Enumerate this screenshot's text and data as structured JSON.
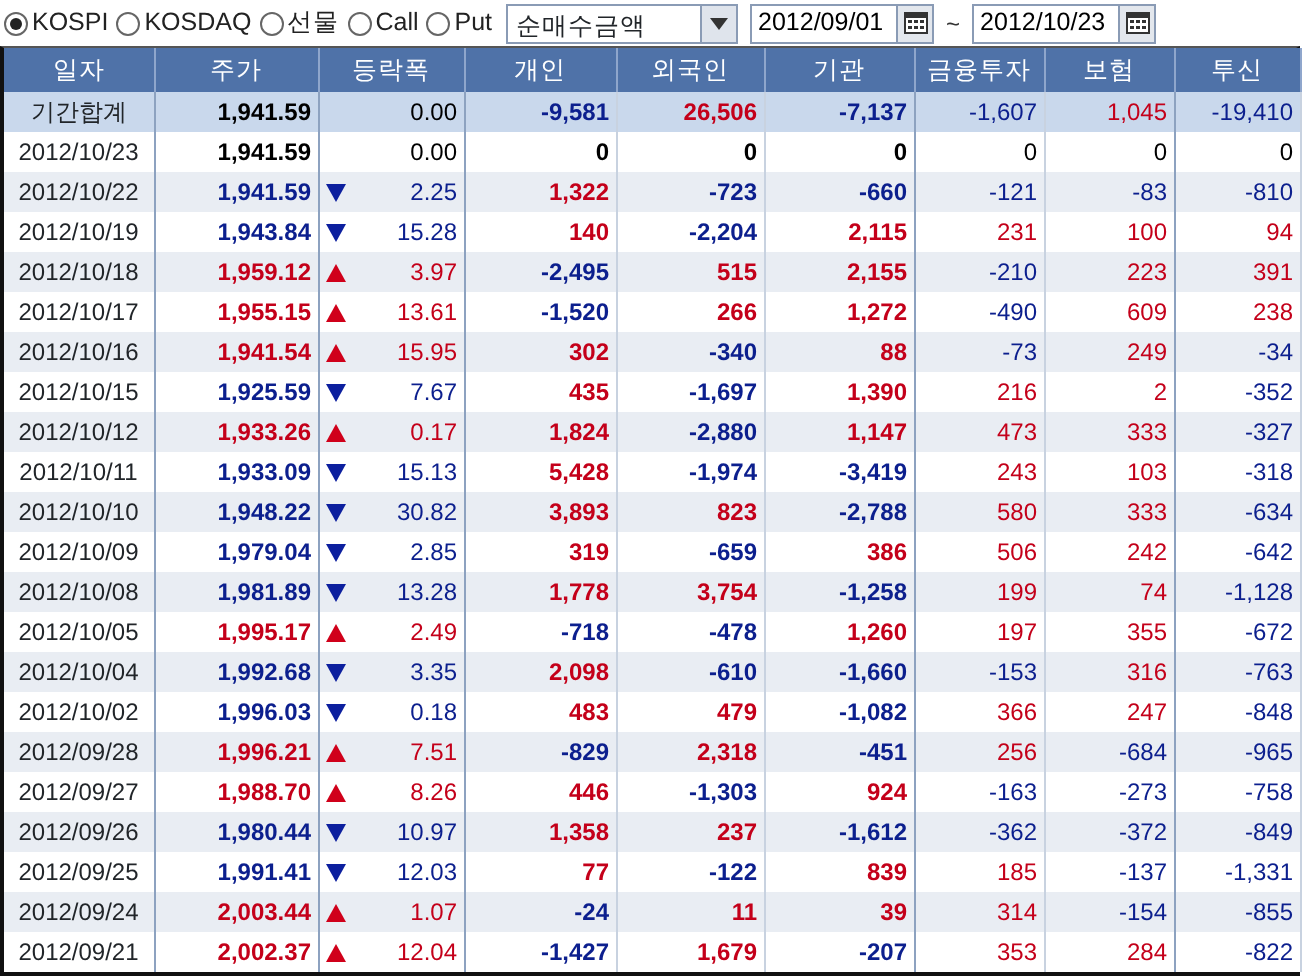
{
  "toolbar": {
    "markets": [
      {
        "label": "KOSPI",
        "selected": true
      },
      {
        "label": "KOSDAQ",
        "selected": false
      },
      {
        "label": "선물",
        "selected": false
      },
      {
        "label": "Call",
        "selected": false
      },
      {
        "label": "Put",
        "selected": false
      }
    ],
    "measure": "순매수금액",
    "date_from": "2012/09/01",
    "separator": "~",
    "date_to": "2012/10/23"
  },
  "table": {
    "columns": [
      "일자",
      "주가",
      "등락폭",
      "개인",
      "외국인",
      "기관",
      "금융투자",
      "보험",
      "투신"
    ],
    "rows": [
      {
        "kind": "total",
        "date": "기간합계",
        "price": {
          "text": "1,941.59",
          "color": "#000000"
        },
        "change": {
          "kind": "none",
          "text": "0.00",
          "color": "#000000"
        },
        "values": [
          {
            "text": "-9,581",
            "color": "#0c1f8e"
          },
          {
            "text": "26,506",
            "color": "#c4001a"
          },
          {
            "text": "-7,137",
            "color": "#0c1f8e"
          },
          {
            "text": "-1,607",
            "color": "#0c1f8e"
          },
          {
            "text": "1,045",
            "color": "#c4001a"
          },
          {
            "text": "-19,410",
            "color": "#0c1f8e"
          }
        ]
      },
      {
        "kind": "day",
        "date": "2012/10/23",
        "price": {
          "text": "1,941.59",
          "color": "#000000"
        },
        "change": {
          "kind": "none",
          "text": "0.00",
          "color": "#000000"
        },
        "values": [
          {
            "text": "0",
            "color": "#000000"
          },
          {
            "text": "0",
            "color": "#000000"
          },
          {
            "text": "0",
            "color": "#000000"
          },
          {
            "text": "0",
            "color": "#000000"
          },
          {
            "text": "0",
            "color": "#000000"
          },
          {
            "text": "0",
            "color": "#000000"
          }
        ]
      },
      {
        "kind": "day",
        "date": "2012/10/22",
        "price": {
          "text": "1,941.59",
          "color": "#0c1f8e"
        },
        "change": {
          "kind": "down",
          "text": "2.25",
          "color": "#0c1f8e"
        },
        "values": [
          {
            "text": "1,322",
            "color": "#c4001a"
          },
          {
            "text": "-723",
            "color": "#0c1f8e"
          },
          {
            "text": "-660",
            "color": "#0c1f8e"
          },
          {
            "text": "-121",
            "color": "#0c1f8e"
          },
          {
            "text": "-83",
            "color": "#0c1f8e"
          },
          {
            "text": "-810",
            "color": "#0c1f8e"
          }
        ]
      },
      {
        "kind": "day",
        "date": "2012/10/19",
        "price": {
          "text": "1,943.84",
          "color": "#0c1f8e"
        },
        "change": {
          "kind": "down",
          "text": "15.28",
          "color": "#0c1f8e"
        },
        "values": [
          {
            "text": "140",
            "color": "#c4001a"
          },
          {
            "text": "-2,204",
            "color": "#0c1f8e"
          },
          {
            "text": "2,115",
            "color": "#c4001a"
          },
          {
            "text": "231",
            "color": "#c4001a"
          },
          {
            "text": "100",
            "color": "#c4001a"
          },
          {
            "text": "94",
            "color": "#c4001a"
          }
        ]
      },
      {
        "kind": "day",
        "date": "2012/10/18",
        "price": {
          "text": "1,959.12",
          "color": "#c4001a"
        },
        "change": {
          "kind": "up",
          "text": "3.97",
          "color": "#c4001a"
        },
        "values": [
          {
            "text": "-2,495",
            "color": "#0c1f8e"
          },
          {
            "text": "515",
            "color": "#c4001a"
          },
          {
            "text": "2,155",
            "color": "#c4001a"
          },
          {
            "text": "-210",
            "color": "#0c1f8e"
          },
          {
            "text": "223",
            "color": "#c4001a"
          },
          {
            "text": "391",
            "color": "#c4001a"
          }
        ]
      },
      {
        "kind": "day",
        "date": "2012/10/17",
        "price": {
          "text": "1,955.15",
          "color": "#c4001a"
        },
        "change": {
          "kind": "up",
          "text": "13.61",
          "color": "#c4001a"
        },
        "values": [
          {
            "text": "-1,520",
            "color": "#0c1f8e"
          },
          {
            "text": "266",
            "color": "#c4001a"
          },
          {
            "text": "1,272",
            "color": "#c4001a"
          },
          {
            "text": "-490",
            "color": "#0c1f8e"
          },
          {
            "text": "609",
            "color": "#c4001a"
          },
          {
            "text": "238",
            "color": "#c4001a"
          }
        ]
      },
      {
        "kind": "day",
        "date": "2012/10/16",
        "price": {
          "text": "1,941.54",
          "color": "#c4001a"
        },
        "change": {
          "kind": "up",
          "text": "15.95",
          "color": "#c4001a"
        },
        "values": [
          {
            "text": "302",
            "color": "#c4001a"
          },
          {
            "text": "-340",
            "color": "#0c1f8e"
          },
          {
            "text": "88",
            "color": "#c4001a"
          },
          {
            "text": "-73",
            "color": "#0c1f8e"
          },
          {
            "text": "249",
            "color": "#c4001a"
          },
          {
            "text": "-34",
            "color": "#0c1f8e"
          }
        ]
      },
      {
        "kind": "day",
        "date": "2012/10/15",
        "price": {
          "text": "1,925.59",
          "color": "#0c1f8e"
        },
        "change": {
          "kind": "down",
          "text": "7.67",
          "color": "#0c1f8e"
        },
        "values": [
          {
            "text": "435",
            "color": "#c4001a"
          },
          {
            "text": "-1,697",
            "color": "#0c1f8e"
          },
          {
            "text": "1,390",
            "color": "#c4001a"
          },
          {
            "text": "216",
            "color": "#c4001a"
          },
          {
            "text": "2",
            "color": "#c4001a"
          },
          {
            "text": "-352",
            "color": "#0c1f8e"
          }
        ]
      },
      {
        "kind": "day",
        "date": "2012/10/12",
        "price": {
          "text": "1,933.26",
          "color": "#c4001a"
        },
        "change": {
          "kind": "up",
          "text": "0.17",
          "color": "#c4001a"
        },
        "values": [
          {
            "text": "1,824",
            "color": "#c4001a"
          },
          {
            "text": "-2,880",
            "color": "#0c1f8e"
          },
          {
            "text": "1,147",
            "color": "#c4001a"
          },
          {
            "text": "473",
            "color": "#c4001a"
          },
          {
            "text": "333",
            "color": "#c4001a"
          },
          {
            "text": "-327",
            "color": "#0c1f8e"
          }
        ]
      },
      {
        "kind": "day",
        "date": "2012/10/11",
        "price": {
          "text": "1,933.09",
          "color": "#0c1f8e"
        },
        "change": {
          "kind": "down",
          "text": "15.13",
          "color": "#0c1f8e"
        },
        "values": [
          {
            "text": "5,428",
            "color": "#c4001a"
          },
          {
            "text": "-1,974",
            "color": "#0c1f8e"
          },
          {
            "text": "-3,419",
            "color": "#0c1f8e"
          },
          {
            "text": "243",
            "color": "#c4001a"
          },
          {
            "text": "103",
            "color": "#c4001a"
          },
          {
            "text": "-318",
            "color": "#0c1f8e"
          }
        ]
      },
      {
        "kind": "day",
        "date": "2012/10/10",
        "price": {
          "text": "1,948.22",
          "color": "#0c1f8e"
        },
        "change": {
          "kind": "down",
          "text": "30.82",
          "color": "#0c1f8e"
        },
        "values": [
          {
            "text": "3,893",
            "color": "#c4001a"
          },
          {
            "text": "823",
            "color": "#c4001a"
          },
          {
            "text": "-2,788",
            "color": "#0c1f8e"
          },
          {
            "text": "580",
            "color": "#c4001a"
          },
          {
            "text": "333",
            "color": "#c4001a"
          },
          {
            "text": "-634",
            "color": "#0c1f8e"
          }
        ]
      },
      {
        "kind": "day",
        "date": "2012/10/09",
        "price": {
          "text": "1,979.04",
          "color": "#0c1f8e"
        },
        "change": {
          "kind": "down",
          "text": "2.85",
          "color": "#0c1f8e"
        },
        "values": [
          {
            "text": "319",
            "color": "#c4001a"
          },
          {
            "text": "-659",
            "color": "#0c1f8e"
          },
          {
            "text": "386",
            "color": "#c4001a"
          },
          {
            "text": "506",
            "color": "#c4001a"
          },
          {
            "text": "242",
            "color": "#c4001a"
          },
          {
            "text": "-642",
            "color": "#0c1f8e"
          }
        ]
      },
      {
        "kind": "day",
        "date": "2012/10/08",
        "price": {
          "text": "1,981.89",
          "color": "#0c1f8e"
        },
        "change": {
          "kind": "down",
          "text": "13.28",
          "color": "#0c1f8e"
        },
        "values": [
          {
            "text": "1,778",
            "color": "#c4001a"
          },
          {
            "text": "3,754",
            "color": "#c4001a"
          },
          {
            "text": "-1,258",
            "color": "#0c1f8e"
          },
          {
            "text": "199",
            "color": "#c4001a"
          },
          {
            "text": "74",
            "color": "#c4001a"
          },
          {
            "text": "-1,128",
            "color": "#0c1f8e"
          }
        ]
      },
      {
        "kind": "day",
        "date": "2012/10/05",
        "price": {
          "text": "1,995.17",
          "color": "#c4001a"
        },
        "change": {
          "kind": "up",
          "text": "2.49",
          "color": "#c4001a"
        },
        "values": [
          {
            "text": "-718",
            "color": "#0c1f8e"
          },
          {
            "text": "-478",
            "color": "#0c1f8e"
          },
          {
            "text": "1,260",
            "color": "#c4001a"
          },
          {
            "text": "197",
            "color": "#c4001a"
          },
          {
            "text": "355",
            "color": "#c4001a"
          },
          {
            "text": "-672",
            "color": "#0c1f8e"
          }
        ]
      },
      {
        "kind": "day",
        "date": "2012/10/04",
        "price": {
          "text": "1,992.68",
          "color": "#0c1f8e"
        },
        "change": {
          "kind": "down",
          "text": "3.35",
          "color": "#0c1f8e"
        },
        "values": [
          {
            "text": "2,098",
            "color": "#c4001a"
          },
          {
            "text": "-610",
            "color": "#0c1f8e"
          },
          {
            "text": "-1,660",
            "color": "#0c1f8e"
          },
          {
            "text": "-153",
            "color": "#0c1f8e"
          },
          {
            "text": "316",
            "color": "#c4001a"
          },
          {
            "text": "-763",
            "color": "#0c1f8e"
          }
        ]
      },
      {
        "kind": "day",
        "date": "2012/10/02",
        "price": {
          "text": "1,996.03",
          "color": "#0c1f8e"
        },
        "change": {
          "kind": "down",
          "text": "0.18",
          "color": "#0c1f8e"
        },
        "values": [
          {
            "text": "483",
            "color": "#c4001a"
          },
          {
            "text": "479",
            "color": "#c4001a"
          },
          {
            "text": "-1,082",
            "color": "#0c1f8e"
          },
          {
            "text": "366",
            "color": "#c4001a"
          },
          {
            "text": "247",
            "color": "#c4001a"
          },
          {
            "text": "-848",
            "color": "#0c1f8e"
          }
        ]
      },
      {
        "kind": "day",
        "date": "2012/09/28",
        "price": {
          "text": "1,996.21",
          "color": "#c4001a"
        },
        "change": {
          "kind": "up",
          "text": "7.51",
          "color": "#c4001a"
        },
        "values": [
          {
            "text": "-829",
            "color": "#0c1f8e"
          },
          {
            "text": "2,318",
            "color": "#c4001a"
          },
          {
            "text": "-451",
            "color": "#0c1f8e"
          },
          {
            "text": "256",
            "color": "#c4001a"
          },
          {
            "text": "-684",
            "color": "#0c1f8e"
          },
          {
            "text": "-965",
            "color": "#0c1f8e"
          }
        ]
      },
      {
        "kind": "day",
        "date": "2012/09/27",
        "price": {
          "text": "1,988.70",
          "color": "#c4001a"
        },
        "change": {
          "kind": "up",
          "text": "8.26",
          "color": "#c4001a"
        },
        "values": [
          {
            "text": "446",
            "color": "#c4001a"
          },
          {
            "text": "-1,303",
            "color": "#0c1f8e"
          },
          {
            "text": "924",
            "color": "#c4001a"
          },
          {
            "text": "-163",
            "color": "#0c1f8e"
          },
          {
            "text": "-273",
            "color": "#0c1f8e"
          },
          {
            "text": "-758",
            "color": "#0c1f8e"
          }
        ]
      },
      {
        "kind": "day",
        "date": "2012/09/26",
        "price": {
          "text": "1,980.44",
          "color": "#0c1f8e"
        },
        "change": {
          "kind": "down",
          "text": "10.97",
          "color": "#0c1f8e"
        },
        "values": [
          {
            "text": "1,358",
            "color": "#c4001a"
          },
          {
            "text": "237",
            "color": "#c4001a"
          },
          {
            "text": "-1,612",
            "color": "#0c1f8e"
          },
          {
            "text": "-362",
            "color": "#0c1f8e"
          },
          {
            "text": "-372",
            "color": "#0c1f8e"
          },
          {
            "text": "-849",
            "color": "#0c1f8e"
          }
        ]
      },
      {
        "kind": "day",
        "date": "2012/09/25",
        "price": {
          "text": "1,991.41",
          "color": "#0c1f8e"
        },
        "change": {
          "kind": "down",
          "text": "12.03",
          "color": "#0c1f8e"
        },
        "values": [
          {
            "text": "77",
            "color": "#c4001a"
          },
          {
            "text": "-122",
            "color": "#0c1f8e"
          },
          {
            "text": "839",
            "color": "#c4001a"
          },
          {
            "text": "185",
            "color": "#c4001a"
          },
          {
            "text": "-137",
            "color": "#0c1f8e"
          },
          {
            "text": "-1,331",
            "color": "#0c1f8e"
          }
        ]
      },
      {
        "kind": "day",
        "date": "2012/09/24",
        "price": {
          "text": "2,003.44",
          "color": "#c4001a"
        },
        "change": {
          "kind": "up",
          "text": "1.07",
          "color": "#c4001a"
        },
        "values": [
          {
            "text": "-24",
            "color": "#0c1f8e"
          },
          {
            "text": "11",
            "color": "#c4001a"
          },
          {
            "text": "39",
            "color": "#c4001a"
          },
          {
            "text": "314",
            "color": "#c4001a"
          },
          {
            "text": "-154",
            "color": "#0c1f8e"
          },
          {
            "text": "-855",
            "color": "#0c1f8e"
          }
        ]
      },
      {
        "kind": "day",
        "date": "2012/09/21",
        "price": {
          "text": "2,002.37",
          "color": "#c4001a"
        },
        "change": {
          "kind": "up",
          "text": "12.04",
          "color": "#c4001a"
        },
        "values": [
          {
            "text": "-1,427",
            "color": "#0c1f8e"
          },
          {
            "text": "1,679",
            "color": "#c4001a"
          },
          {
            "text": "-207",
            "color": "#0c1f8e"
          },
          {
            "text": "353",
            "color": "#c4001a"
          },
          {
            "text": "284",
            "color": "#c4001a"
          },
          {
            "text": "-822",
            "color": "#0c1f8e"
          }
        ]
      }
    ]
  }
}
